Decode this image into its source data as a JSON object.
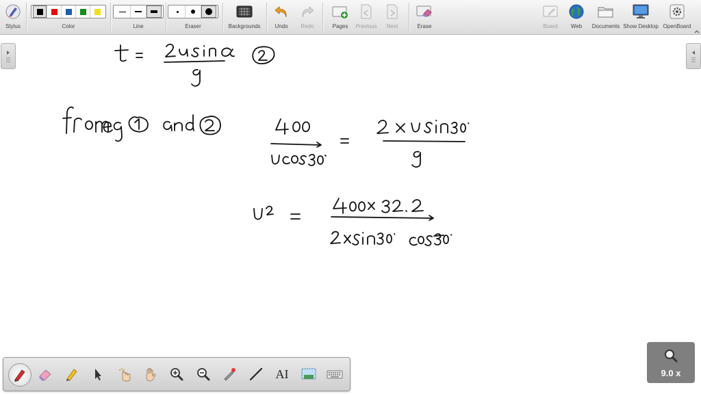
{
  "toolbar": {
    "stylus_label": "Stylus",
    "color_label": "Color",
    "line_label": "Line",
    "eraser_label": "Eraser",
    "backgrounds_label": "Backgrounds",
    "undo_label": "Undo",
    "redo_label": "Redo",
    "pages_label": "Pages",
    "previous_label": "Previous",
    "next_label": "Next",
    "erase_label": "Erase",
    "board_label": "Board",
    "web_label": "Web",
    "documents_label": "Documents",
    "show_desktop_label": "Show Desktop",
    "openboard_label": "OpenBoard",
    "colors": [
      "#000000",
      "#e01010",
      "#1a5fa8",
      "#1a8a1a",
      "#f0e020"
    ],
    "selected_color_index": 0,
    "line_widths": [
      "thin",
      "medium",
      "thick"
    ],
    "eraser_sizes": [
      "small",
      "medium",
      "large"
    ]
  },
  "board": {
    "ink_color": "#111111"
  },
  "palette": {
    "tools": [
      "pen-icon",
      "eraser-icon",
      "highlighter-icon",
      "selector-icon",
      "interactor-icon",
      "hand-icon",
      "zoom-in-icon",
      "zoom-out-icon",
      "laser-pointer-icon",
      "line-icon",
      "text-icon",
      "capture-icon",
      "keyboard-icon"
    ],
    "selected_tool": "pen-icon",
    "text_tool_label": "AI"
  },
  "zoom": {
    "value": "9.0 x"
  }
}
